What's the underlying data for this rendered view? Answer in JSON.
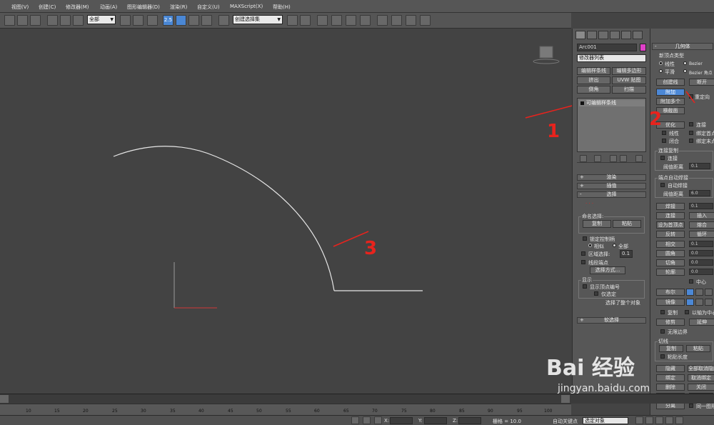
{
  "menubar": {
    "items": [
      "视图(V)",
      "创建(C)",
      "修改器(M)",
      "动画(A)",
      "图形编辑器(D)",
      "渲染(R)",
      "自定义(U)",
      "MAXScript(X)",
      "帮助(H)"
    ]
  },
  "toolbar": {
    "filter_select": "全部",
    "snap_value": "2.5",
    "named_selection": "创建选择集"
  },
  "viewport": {
    "curve_color": "#e6e6e6",
    "axis_red": "#d23a3a"
  },
  "annotations": {
    "mark_1": "1",
    "mark_2": "2",
    "mark_3": "3"
  },
  "command_panel": {
    "object_name": "Arc001",
    "object_color": "#e040c8",
    "modifier_list": "修改器列表",
    "buttons": [
      "编辑样条线",
      "编辑多边形",
      "挤出",
      "UVW 贴图",
      "倒角",
      "扫描"
    ],
    "stack_item": "可编辑样条线",
    "rollouts": {
      "render": "渲染",
      "interpolation": "插值",
      "selection": "选择",
      "soft_selection": "软选择"
    },
    "named_selection": {
      "title": "命名选择:",
      "copy": "复制",
      "paste": "粘贴"
    },
    "lock_handles": "锁定控制柄",
    "similar": "相似",
    "all": "全部",
    "area_select": "区域选择:",
    "area_value": "0.1",
    "segment_end": "线段端点",
    "select_by": "选择方式...",
    "display_group": "显示",
    "show_vertex_numbers": "显示顶点编号",
    "selected_only": "仅选定",
    "status": "选择了整个对象"
  },
  "geometry_panel": {
    "title": "几何体",
    "new_vertex_type": "新顶点类型",
    "linear": "线性",
    "bezier": "Bezier",
    "smooth": "平滑",
    "bezier_corner": "Bezier 角点",
    "create_line": "创建线",
    "break": "断开",
    "attach": "附加",
    "reorient": "重定向",
    "attach_multiple": "附加多个",
    "cross_section": "横截面",
    "optimize": "优化",
    "connect": "连接",
    "linear2": "线性",
    "bind_first": "绑定首点",
    "closed": "闭合",
    "bind_last": "绑定末点",
    "connect_copy": "连接复制",
    "connect_chk": "连接",
    "threshold": "阈值距离",
    "threshold_val": "0.1",
    "auto_weld_group": "端点自动焊接",
    "auto_weld": "自动焊接",
    "threshold2": "阈值距离",
    "threshold2_val": "6.0",
    "weld": "焊接",
    "weld_val": "0.1",
    "connect2": "连接",
    "insert": "插入",
    "make_first": "设为首顶点",
    "fuse": "熔合",
    "reverse": "反转",
    "cycle": "循环",
    "cross_insert": "相交",
    "cross_val": "0.1",
    "fillet": "圆角",
    "fillet_val": "0.0",
    "chamfer": "切角",
    "chamfer_val": "0.0",
    "outline": "轮廓",
    "outline_val": "0.0",
    "center": "中心",
    "boolean": "布尔",
    "mirror": "镜像",
    "copy": "复制",
    "about_pivot": "以轴为中心",
    "trim": "修剪",
    "extend": "延伸",
    "infinite_bounds": "无限边界",
    "tangent_group": "切线",
    "tcopy": "复制",
    "tpaste": "粘贴",
    "paste_length": "粘贴长度",
    "hide": "隐藏",
    "unhide_all": "全部取消隐藏",
    "bind": "绑定",
    "unbind": "取消绑定",
    "delete": "删除",
    "close": "关闭",
    "divide": "拆分",
    "divide_val": "1",
    "detach": "分离",
    "same_shape": "同一图形"
  },
  "timeline": {
    "ticks": [
      "10",
      "15",
      "20",
      "25",
      "30",
      "35",
      "40",
      "45",
      "50",
      "55",
      "60",
      "65",
      "70",
      "75",
      "80",
      "85",
      "90",
      "95",
      "100"
    ]
  },
  "statusbar": {
    "x_label": "X:",
    "y_label": "Y:",
    "z_label": "Z:",
    "grid": "栅格 = 10.0",
    "auto_key": "自动关键点",
    "selected_object": "选定对象"
  },
  "watermark": {
    "brand": "Bai 经验",
    "url": "jingyan.baidu.com"
  }
}
